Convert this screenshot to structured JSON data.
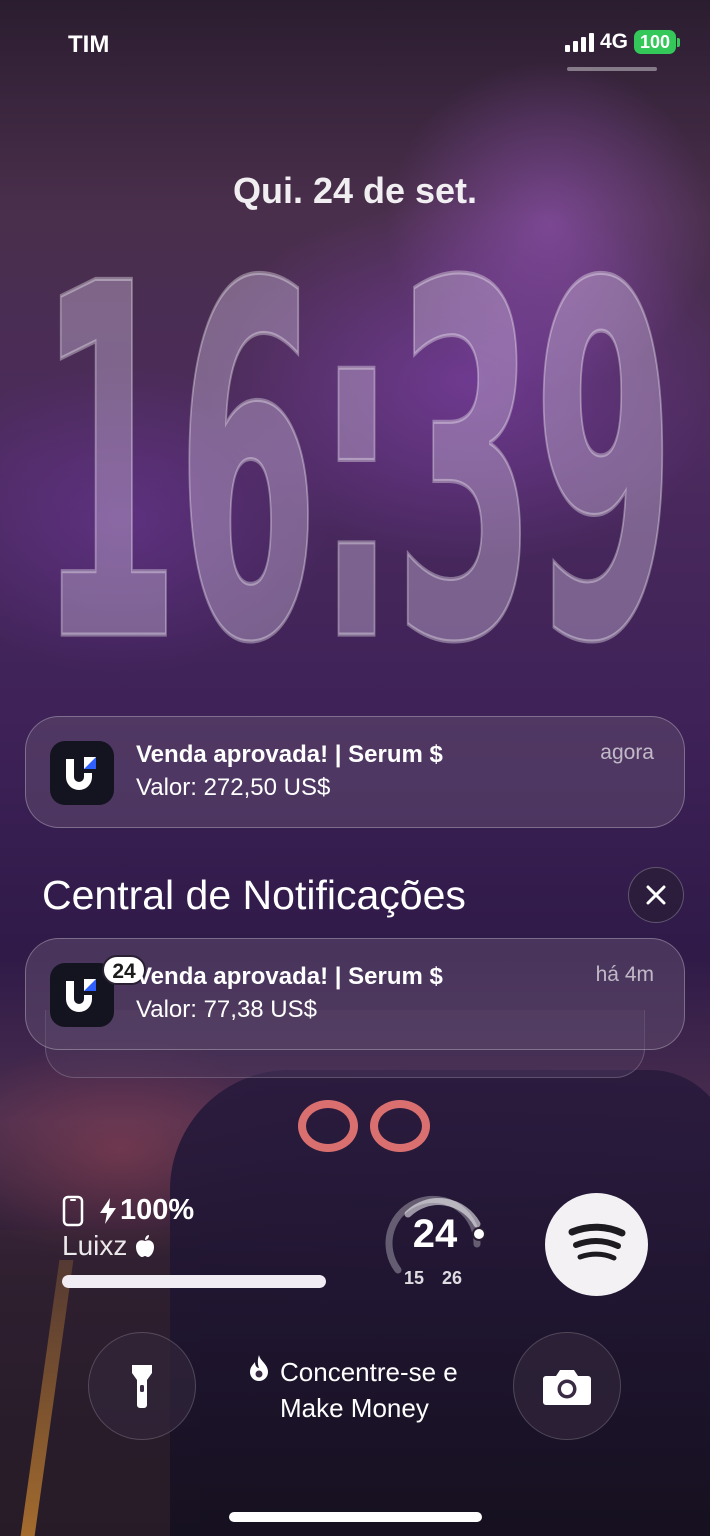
{
  "status_bar": {
    "carrier": "TIM",
    "network": "4G",
    "battery": "100",
    "battery_color": "#34c759"
  },
  "lockscreen": {
    "date": "Qui. 24 de set.",
    "time": "16:39"
  },
  "notification_top": {
    "app_icon": "app-logo-icon",
    "title": "Venda aprovada! | Serum $",
    "body": "Valor: 272,50 US$",
    "time": "agora"
  },
  "notification_center": {
    "title": "Central de Notificações",
    "close_icon": "close-icon"
  },
  "notification_stack": {
    "app_icon": "app-logo-icon",
    "badge": "24",
    "title": "Venda aprovada! | Serum $",
    "body": "Valor: 77,38 US$",
    "time": "há 4m"
  },
  "widgets": {
    "battery": {
      "percent": "100%",
      "device": "Luixz",
      "level": 1.0,
      "icons": [
        "phone-icon",
        "bolt-icon",
        "apple-icon"
      ]
    },
    "weather": {
      "current": "24",
      "low": "15",
      "high": "26"
    },
    "spotify_icon": "spotify-icon"
  },
  "bottom": {
    "flashlight_icon": "flashlight-icon",
    "camera_icon": "camera-icon",
    "focus_icon": "flame-icon",
    "focus_line1": "Concentre-se e",
    "focus_line2": "Make Money"
  }
}
